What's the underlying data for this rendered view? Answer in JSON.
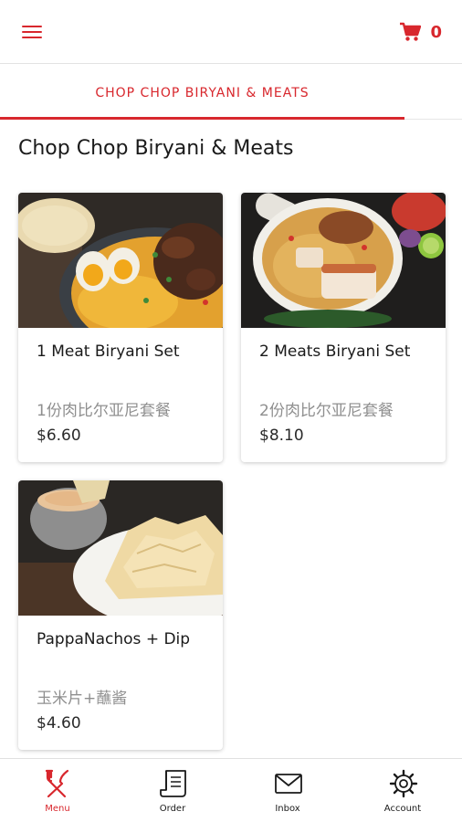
{
  "header": {
    "menu_icon": "hamburger-icon",
    "cart_icon": "shopping-cart-icon",
    "cart_count": "0"
  },
  "tabs": [
    {
      "label": "CHOP CHOP BIRYANI & MEATS",
      "active": true
    }
  ],
  "section": {
    "title": "Chop Chop Biryani & Meats"
  },
  "products": [
    {
      "name": "1 Meat Biryani Set",
      "name_cn": "1份肉比尔亚尼套餐",
      "price": "$6.60",
      "image": "biryani-plate-photo"
    },
    {
      "name": "2 Meats Biryani Set",
      "name_cn": "2份肉比尔亚尼套餐",
      "price": "$8.10",
      "image": "biryani-bowl-photo"
    },
    {
      "name": "PappaNachos + Dip",
      "name_cn": "玉米片+蘸酱",
      "price": "$4.60",
      "image": "papadum-nachos-photo"
    }
  ],
  "bottom_nav": [
    {
      "label": "Menu",
      "icon": "fork-knife-icon",
      "active": true
    },
    {
      "label": "Order",
      "icon": "receipt-icon",
      "active": false
    },
    {
      "label": "Inbox",
      "icon": "envelope-icon",
      "active": false
    },
    {
      "label": "Account",
      "icon": "gear-icon",
      "active": false
    }
  ],
  "colors": {
    "accent": "#d8272d",
    "secondary_text": "#8f8f8f"
  }
}
